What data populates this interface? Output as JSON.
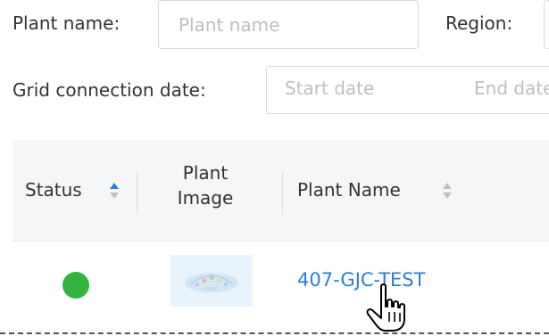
{
  "filters": {
    "plant_name": {
      "label": "Plant name:",
      "placeholder": "Plant name"
    },
    "region": {
      "label": "Region:"
    },
    "grid_connection_date": {
      "label": "Grid connection date:",
      "start_placeholder": "Start date",
      "end_placeholder": "End date"
    }
  },
  "table": {
    "columns": [
      {
        "label": "Status",
        "sort": "ascending"
      },
      {
        "label": "Plant\nImage"
      },
      {
        "label": "Plant Name",
        "sort": "none"
      }
    ],
    "rows": [
      {
        "status": "online",
        "status_color": "#34b43f",
        "plant_name": "407-GJC-TEST"
      }
    ]
  },
  "colors": {
    "link": "#2d7fd3",
    "sort_active": "#2d7fd3",
    "sort_inactive": "#c0c0c0",
    "header_background": "#f5f6f8"
  },
  "cursor": "hand-pointer-icon"
}
